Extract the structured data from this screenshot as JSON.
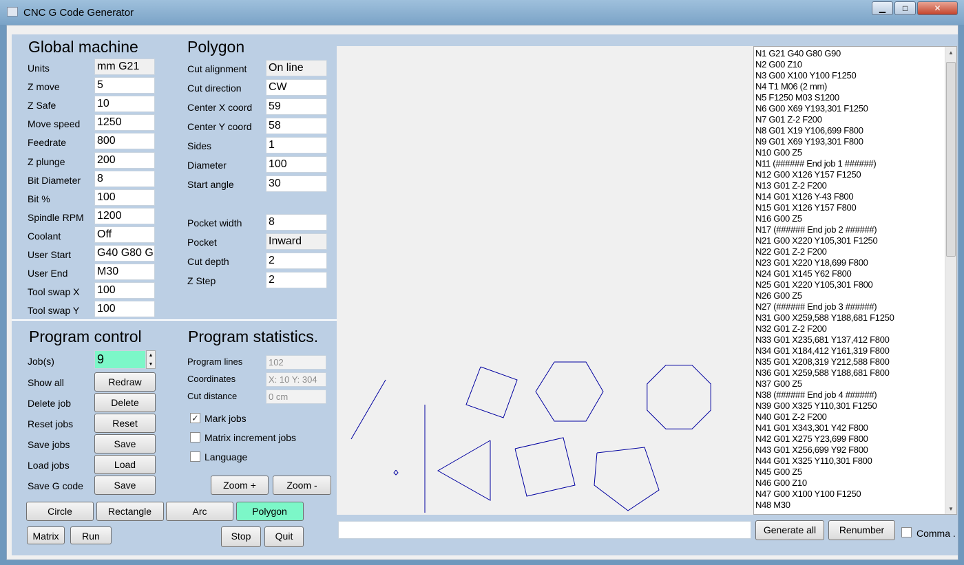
{
  "window": {
    "title": "CNC G Code Generator",
    "minimize": "▁",
    "maximize": "□",
    "close": "✕"
  },
  "global": {
    "title": "Global machine",
    "fields": [
      {
        "label": "Units",
        "value": "mm G21",
        "readonly": true
      },
      {
        "label": "Z move",
        "value": "5"
      },
      {
        "label": "Z Safe",
        "value": "10"
      },
      {
        "label": "Move speed",
        "value": "1250"
      },
      {
        "label": "Feedrate",
        "value": "800"
      },
      {
        "label": "Z plunge",
        "value": "200"
      },
      {
        "label": "Bit Diameter",
        "value": "8"
      },
      {
        "label": "Bit %",
        "value": "100"
      },
      {
        "label": "Spindle RPM",
        "value": "1200"
      },
      {
        "label": "Coolant",
        "value": "Off"
      },
      {
        "label": "User Start",
        "value": "G40 G80 G"
      },
      {
        "label": "User End",
        "value": "M30"
      },
      {
        "label": "Tool swap X",
        "value": "100"
      },
      {
        "label": "Tool swap Y",
        "value": "100"
      }
    ]
  },
  "polygon": {
    "title": "Polygon",
    "fields": [
      {
        "label": "Cut alignment",
        "value": "On line",
        "readonly": true
      },
      {
        "label": "Cut direction",
        "value": "CW"
      },
      {
        "label": "Center X coord",
        "value": "59"
      },
      {
        "label": "Center Y coord",
        "value": "58"
      },
      {
        "label": "Sides",
        "value": "1"
      },
      {
        "label": "Diameter",
        "value": "100"
      },
      {
        "label": "Start angle",
        "value": "30"
      }
    ],
    "fields2": [
      {
        "label": "Pocket width",
        "value": "8"
      },
      {
        "label": "Pocket",
        "value": "Inward",
        "readonly": true
      },
      {
        "label": "Cut depth",
        "value": "2"
      },
      {
        "label": "Z Step",
        "value": "2"
      }
    ]
  },
  "control": {
    "title": "Program control",
    "jobs_label": "Job(s)",
    "jobs_value": "9",
    "rows": [
      {
        "label": "Show all",
        "button": "Redraw"
      },
      {
        "label": "Delete job",
        "button": "Delete"
      },
      {
        "label": "Reset jobs",
        "button": "Reset"
      },
      {
        "label": "Save jobs",
        "button": "Save"
      },
      {
        "label": "Load jobs",
        "button": "Load"
      },
      {
        "label": "Save G code",
        "button": "Save"
      }
    ]
  },
  "stats": {
    "title": "Program statistics.",
    "rows": [
      {
        "label": "Program lines",
        "value": "102"
      },
      {
        "label": "Coordinates",
        "value": "X: 10  Y: 304"
      },
      {
        "label": "Cut distance",
        "value": "0 cm"
      }
    ],
    "checks": [
      {
        "label": "Mark jobs",
        "checked": true
      },
      {
        "label": "Matrix increment jobs",
        "checked": false
      },
      {
        "label": "Language",
        "checked": false
      }
    ],
    "zoom_in": "Zoom +",
    "zoom_out": "Zoom -"
  },
  "modes": [
    {
      "label": "Circle"
    },
    {
      "label": "Rectangle"
    },
    {
      "label": "Arc"
    },
    {
      "label": "Polygon",
      "active": true
    }
  ],
  "bottom": {
    "matrix": "Matrix",
    "run": "Run",
    "stop": "Stop",
    "quit": "Quit",
    "generate": "Generate all",
    "renumber": "Renumber",
    "comma": "Comma .",
    "command_value": ""
  },
  "shape_color": "#0000a0",
  "gcode": [
    "N1 G21 G40 G80 G90",
    "N2 G00 Z10",
    "N3 G00 X100 Y100 F1250",
    "N4 T1 M06 (2 mm)",
    "N5  F1250 M03 S1200",
    "N6 G00 X69 Y193,301 F1250",
    "N7 G01 Z-2 F200",
    "N8 G01 X19 Y106,699 F800",
    "N9 G01 X69 Y193,301 F800",
    "N10 G00 Z5",
    "N11 (###### End job 1  ######)",
    "N12 G00 X126 Y157 F1250",
    "N13 G01 Z-2 F200",
    "N14 G01 X126 Y-43 F800",
    "N15 G01 X126 Y157 F800",
    "N16 G00 Z5",
    "N17 (###### End job 2  ######)",
    "N21 G00 X220 Y105,301 F1250",
    "N22 G01 Z-2 F200",
    "N23 G01 X220 Y18,699 F800",
    "N24 G01 X145 Y62 F800",
    "N25 G01 X220 Y105,301 F800",
    "N26 G00 Z5",
    "N27 (###### End job 3  ######)",
    "N31 G00 X259,588 Y188,681 F1250",
    "N32 G01 Z-2 F200",
    "N33 G01 X235,681 Y137,412 F800",
    "N34 G01 X184,412 Y161,319 F800",
    "N35 G01 X208,319 Y212,588 F800",
    "N36 G01 X259,588 Y188,681 F800",
    "N37 G00 Z5",
    "N38 (###### End job 4  ######)",
    "N39 G00 X325 Y110,301 F1250",
    "N40 G01 Z-2 F200",
    "N41 G01 X343,301 Y42 F800",
    "N42 G01 X275 Y23,699 F800",
    "N43 G01 X256,699 Y92 F800",
    "N44 G01 X325 Y110,301 F800",
    "N45 G00 Z5",
    "N46 G00 Z10",
    "N47 G00 X100 Y100 F1250",
    "N48 M30"
  ]
}
